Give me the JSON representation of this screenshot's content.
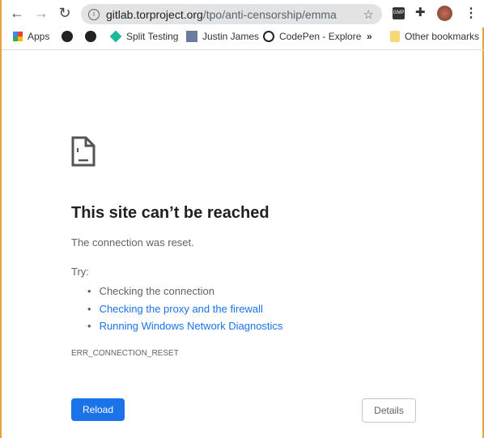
{
  "browser": {
    "url_host": "gitlab.torproject.org",
    "url_path": "/tpo/anti-censorship/emma",
    "extension_label": "GMP",
    "bookmarks": [
      {
        "label": "Apps",
        "icon": "apps-grid-icon"
      },
      {
        "label": "",
        "icon": "globe-icon"
      },
      {
        "label": "",
        "icon": "globe-icon"
      },
      {
        "label": "Split Testing",
        "icon": "diamond-icon"
      },
      {
        "label": "Justin James",
        "icon": "avatar-icon"
      },
      {
        "label": "CodePen - Explore",
        "icon": "codepen-icon"
      }
    ],
    "overflow_label": "»",
    "other_bookmarks": "Other bookmarks"
  },
  "error": {
    "title": "This site can’t be reached",
    "message": "The connection was reset.",
    "try_label": "Try:",
    "suggestions": [
      "Checking the connection",
      "Checking the proxy and the firewall",
      "Running Windows Network Diagnostics"
    ],
    "code": "ERR_CONNECTION_RESET",
    "reload_label": "Reload",
    "details_label": "Details"
  },
  "colors": {
    "accent": "#1a73e8",
    "link": "#1a73e8"
  }
}
